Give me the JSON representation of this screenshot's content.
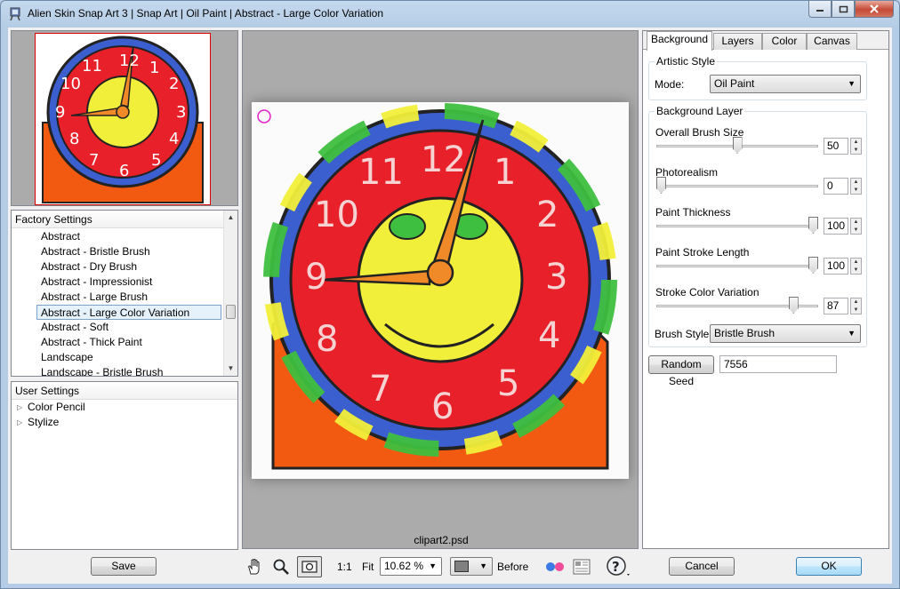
{
  "window": {
    "title": "Alien Skin Snap Art 3 | Snap Art | Oil Paint | Abstract - Large Color Variation"
  },
  "presets": {
    "header": "Factory Settings",
    "items": [
      "Abstract",
      "Abstract - Bristle Brush",
      "Abstract - Dry Brush",
      "Abstract - Impressionist",
      "Abstract - Large Brush",
      "Abstract - Large Color Variation",
      "Abstract - Soft",
      "Abstract - Thick Paint",
      "Landscape",
      "Landscape - Bristle Brush"
    ],
    "selected": "Abstract - Large Color Variation"
  },
  "user_settings": {
    "header": "User Settings",
    "items": [
      "Color Pencil",
      "Stylize"
    ]
  },
  "preview": {
    "filename": "clipart2.psd",
    "clock_numbers": [
      "12",
      "1",
      "2",
      "3",
      "4",
      "5",
      "6",
      "7",
      "8",
      "9",
      "10",
      "11"
    ]
  },
  "tabs": [
    "Background",
    "Layers",
    "Color",
    "Canvas"
  ],
  "artistic_style": {
    "title": "Artistic Style",
    "mode_label": "Mode:",
    "mode_value": "Oil Paint"
  },
  "background_layer": {
    "title": "Background Layer",
    "sliders": [
      {
        "label": "Overall Brush Size",
        "value": "50",
        "fraction": 0.5
      },
      {
        "label": "Photorealism",
        "value": "0",
        "fraction": 0.0
      },
      {
        "label": "Paint Thickness",
        "value": "100",
        "fraction": 1.0
      },
      {
        "label": "Paint Stroke Length",
        "value": "100",
        "fraction": 1.0
      },
      {
        "label": "Stroke Color Variation",
        "value": "87",
        "fraction": 0.87
      }
    ],
    "brush_style_label": "Brush Style",
    "brush_style_value": "Bristle Brush"
  },
  "random_seed": {
    "button": "Random Seed",
    "value": "7556"
  },
  "bottom": {
    "save": "Save",
    "one_to_one": "1:1",
    "fit": "Fit",
    "zoom": "10.62 %",
    "before": "Before",
    "cancel": "Cancel",
    "ok": "OK"
  },
  "colors": {
    "face_red": "#e8202a",
    "face_yellow": "#f2ef3a",
    "base_orange": "#f25a12",
    "hand_orange": "#f08a28",
    "rim_blue": "#3b5fcf",
    "rim_green": "#3fbf3f",
    "selection_border": "#7da2ce"
  }
}
